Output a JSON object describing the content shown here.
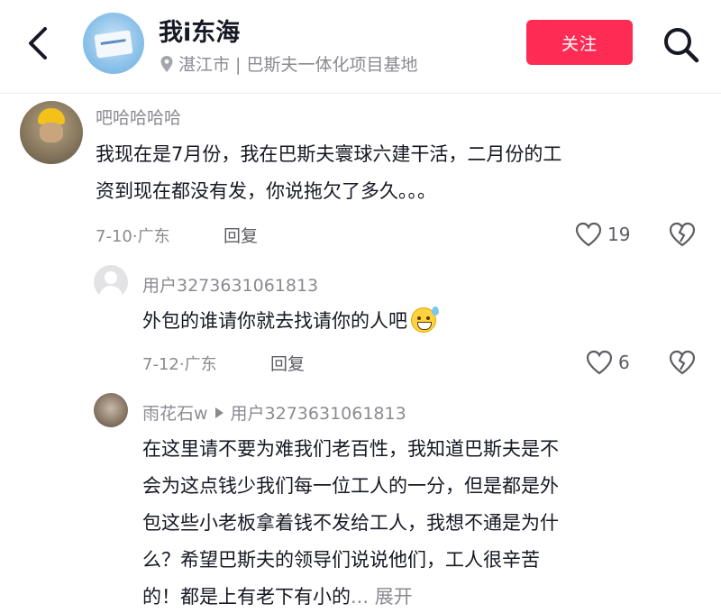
{
  "header": {
    "back_icon": "chevron-left-icon",
    "title": "我i东海",
    "location": "湛江市 | 巴斯夫一体化项目基地",
    "follow_label": "关注",
    "search_icon": "search-icon",
    "accent_color": "#fe2c55"
  },
  "comments": [
    {
      "username": "吧哈哈哈哈",
      "lines": [
        "我现在是7月份，我在巴斯夫寰球六建干活，二月份的工",
        "资到现在都没有发，你说拖欠了多久。。。"
      ],
      "meta": "7-10·广东",
      "reply_label": "回复",
      "likes": "19"
    },
    {
      "username": "用户3273631061813",
      "lines": [
        "外包的谁请你就去找请你的人吧"
      ],
      "emoji": "grinning-sweat-emoji",
      "meta": "7-12·广东",
      "reply_label": "回复",
      "likes": "6"
    },
    {
      "username": "雨花石w",
      "reply_to": "用户3273631061813",
      "lines": [
        "在这里请不要为难我们老百性，我知道巴斯夫是不",
        "会为这点钱少我们每一位工人的一分，但是都是外",
        "包这些小老板拿着钱不发给工人，我想不通是为什",
        "么？希望巴斯夫的领导们说说他们，工人很辛苦",
        "的！都是上有老下有小的"
      ],
      "expand_label": "... 展开"
    }
  ]
}
